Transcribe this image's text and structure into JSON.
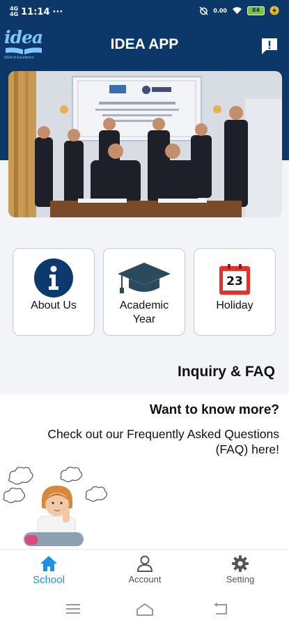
{
  "status": {
    "time": "11:14",
    "dots": "···",
    "network": "4G",
    "network_sub": "4G",
    "data_rate": "0.00",
    "battery": "84"
  },
  "header": {
    "app_title": "IDEA APP",
    "logo_text": "idea",
    "logo_tagline": "IDEA of Excellence"
  },
  "tiles": [
    {
      "label": "About Us",
      "icon": "info-icon"
    },
    {
      "label": "Academic Year",
      "icon": "graduation-cap-icon"
    },
    {
      "label": "Holiday",
      "icon": "calendar-icon",
      "date_number": "23"
    }
  ],
  "inquiry": {
    "title": "Inquiry & FAQ",
    "heading": "Want to know more?",
    "text": "Check out our Frequently Asked Questions (FAQ) here!"
  },
  "nav": [
    {
      "label": "School",
      "icon": "home-icon",
      "active": true
    },
    {
      "label": "Account",
      "icon": "account-icon",
      "active": false
    },
    {
      "label": "Setting",
      "icon": "gear-icon",
      "active": false
    }
  ],
  "colors": {
    "header_blue": "#0b3868",
    "accent_blue": "#1e90e8",
    "holiday_red": "#e4312b"
  }
}
